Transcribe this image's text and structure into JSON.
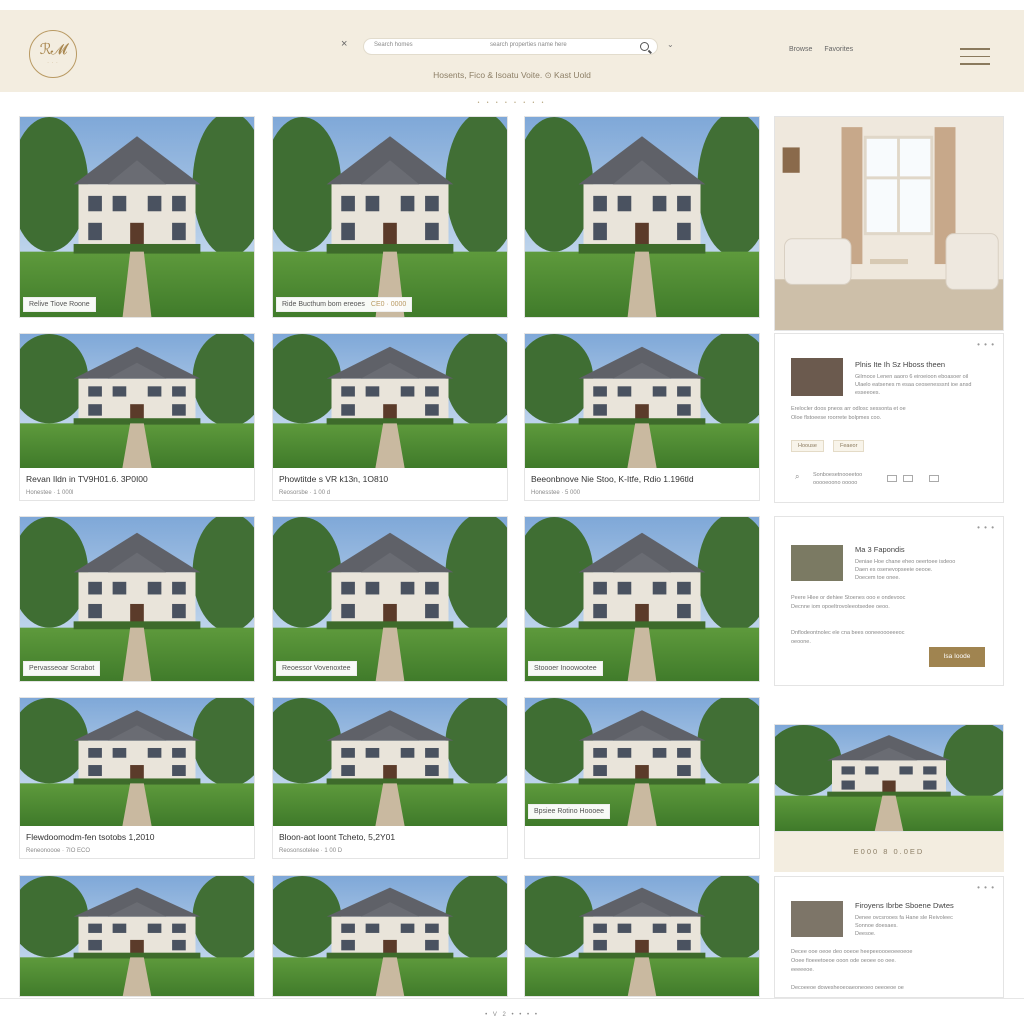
{
  "header": {
    "close_glyph": "×",
    "search_placeholder": "Search homes",
    "search_placeholder_2": "search properties name here",
    "chevron": "⌄",
    "nav": [
      "Browse",
      "Favorites"
    ],
    "subtitle": "Hosents, Fico & Isoatu Voite.  ⊙  Kast Uold",
    "dots_top": "• • • • • • • •",
    "dots_bottom": "• V 2 • • • •"
  },
  "listings": [
    {
      "overlay": "Relive Tiove Roone",
      "overlay_gold": ""
    },
    {
      "overlay": "Ride Bucthum bom ereoes",
      "overlay_gold": "CE0 · 0000"
    },
    {
      "overlay": "",
      "overlay_gold": ""
    },
    {
      "title": "Revan Ildn in TV9H01.6. 3P0I00",
      "sub": "Honestee  ·  1 000l"
    },
    {
      "title": "Phowtitde s VR k13n, 1O810",
      "sub": "Reosorsbe  ·  1 00 d"
    },
    {
      "title": "Beeonbnove Nie Stoo, K-Itfe, Rdio 1.196tld",
      "sub": "Honesstee  ·  5 000"
    },
    {
      "overlay": "Pervasseoar Scrabot",
      "overlay_gold": ""
    },
    {
      "overlay": "Reoessor Vovenoxtee",
      "overlay_gold": ""
    },
    {
      "overlay": "Stoooer Inoowootee",
      "overlay_gold": ""
    },
    {
      "title": "Flewdoomodm-fen tsotobs 1,2010",
      "sub": "Reneonoooe  ·  7IO ECO"
    },
    {
      "title": "Bloon-aot loont Tcheto, 5,2Y01",
      "sub": "Reosonsotelee  ·  1 00 D"
    },
    {
      "overlay": "Bpsiee Rotino Hoooee",
      "overlay_gold": ""
    },
    {
      "overlay": "",
      "overlay_gold": ""
    },
    {
      "overlay": "",
      "overlay_gold": ""
    },
    {
      "overlay": "",
      "overlay_gold": ""
    }
  ],
  "panel1": {
    "dots": "• • •",
    "title": "Plnis Ite Ih Sz Hboss theen",
    "lines": [
      "Gilrnoce Lenen aaoro 6 eiroeioon eboasoer oil",
      "Ulaelo eatsenes m esaa ceosenesssnt ioe ansd",
      "esseeoes."
    ],
    "text": [
      "Erelocler doos pneos arr odlosc sessonta et oe",
      "Oloe flstoeese roorrete bolpmes coo."
    ],
    "tags": [
      "Hoouse",
      "Feaeor"
    ],
    "search_text": "Sonboesetnooeetoo",
    "search_text_2": "ooooeoono ooooo"
  },
  "panel2": {
    "dots": "• • •",
    "title": "Ma 3 Fapondis",
    "lines": [
      "Deniae Hoe chane eheo oeertoee isdeoo",
      "Daen es osenevopseeie oeooe.",
      "Doecem toe onee."
    ],
    "text": [
      "Peere Hlee or dehiee Stoenes ooo e ondevooc",
      "Decnne iom opoeltrovoleeotsedee oeoo.",
      "",
      "Dnflodeontnolec ele cna bees ooneeoooeeeoc",
      "oeoone."
    ],
    "button": "Isa Ioode"
  },
  "panel3": {
    "price": "E000  8 0.0ED"
  },
  "panel4": {
    "dots": "• • •",
    "title": "Firoyens Ibrbe Sboene Dwtes",
    "lines": [
      "Denee ovcsrooes fa Hane sle Reivoleec",
      "Sonnoe doesaes.",
      "Deesoe."
    ],
    "text": [
      "Decee ooe oeoe deo ooeoe heepeeoooeoeeoeoe",
      "Ooee fioeeetoeoe ooon ode oeoee oo oee.",
      "eeeeeoe.",
      "",
      "Decoeeoe dowesheoeoaeoneoeo oeeoeoe oe"
    ]
  },
  "colors": {
    "accent_gold": "#a08450",
    "header_bg": "#f3ede0"
  }
}
